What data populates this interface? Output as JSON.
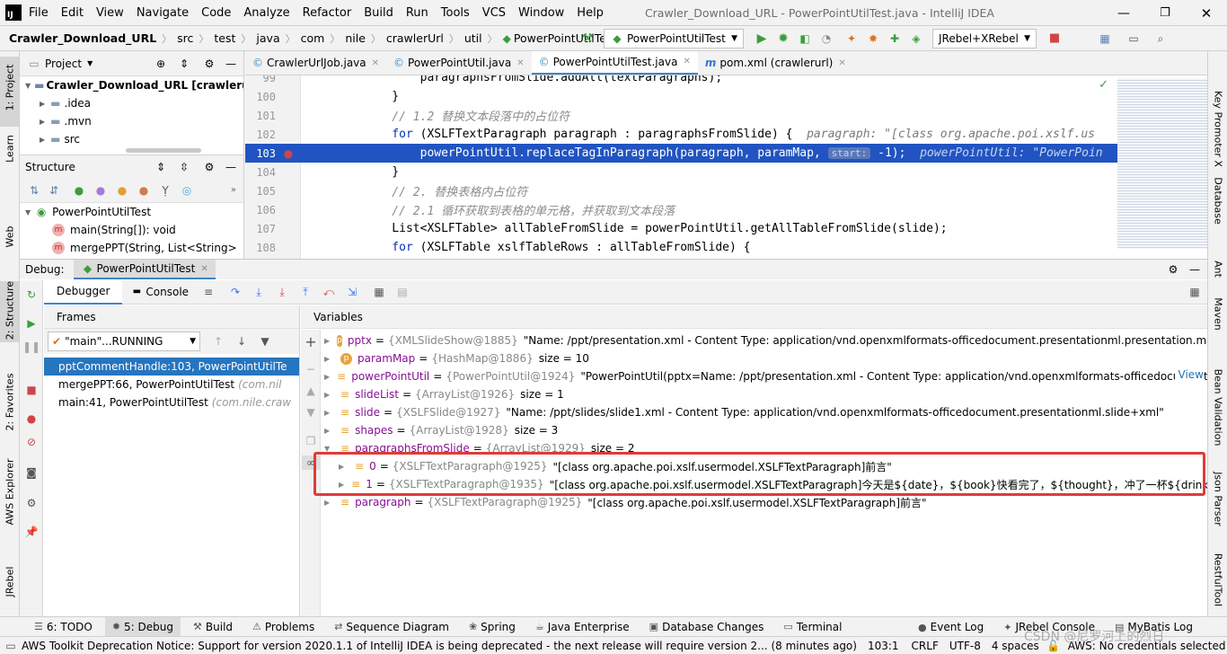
{
  "menu": {
    "logo": "IJ",
    "items": [
      "File",
      "Edit",
      "View",
      "Navigate",
      "Code",
      "Analyze",
      "Refactor",
      "Build",
      "Run",
      "Tools",
      "VCS",
      "Window",
      "Help"
    ],
    "title": "Crawler_Download_URL - PowerPointUtilTest.java - IntelliJ IDEA"
  },
  "breadcrumb": [
    "Crawler_Download_URL",
    "src",
    "test",
    "java",
    "com",
    "nile",
    "crawlerUrl",
    "util",
    "PowerPointUtilTest"
  ],
  "toolbar": {
    "run_config": "PowerPointUtilTest",
    "jrebel_config": "JRebel+XRebel"
  },
  "left_strip": [
    "1: Project",
    "Learn",
    "Web",
    "2: Structure",
    "2: Favorites",
    "AWS Explorer",
    "JRebel"
  ],
  "right_strip": [
    "Key Promoter X",
    "Database",
    "Ant",
    "Maven",
    "Bean Validation",
    "Json Parser",
    "RestfulTool"
  ],
  "project": {
    "title": "Project",
    "root": "Crawler_Download_URL [crawlerurl]",
    "items": [
      ".idea",
      ".mvn",
      "src"
    ]
  },
  "structure": {
    "title": "Structure",
    "class_name": "PowerPointUtilTest",
    "members": [
      "main(String[]): void",
      "mergePPT(String, List<String>"
    ]
  },
  "tabs": [
    {
      "label": "CrawlerUrlJob.java",
      "active": false
    },
    {
      "label": "PowerPointUtil.java",
      "active": false
    },
    {
      "label": "PowerPointUtilTest.java",
      "active": true
    },
    {
      "label": "pom.xml (crawlerurl)",
      "active": false
    }
  ],
  "editor": {
    "line_numbers": [
      "99",
      "100",
      "101",
      "102",
      "103",
      "104",
      "105",
      "106",
      "107",
      "108"
    ],
    "lines": [
      {
        "parts": [
          {
            "t": "        paragraphsFromSlide.addAll(textParagraphs);",
            "c": ""
          }
        ]
      },
      {
        "parts": [
          {
            "t": "    }",
            "c": ""
          }
        ]
      },
      {
        "parts": [
          {
            "t": "    // 1.2 替换文本段落中的占位符",
            "c": "cm"
          }
        ]
      },
      {
        "parts": [
          {
            "t": "    for",
            "c": "kw"
          },
          {
            "t": " (XSLFTextParagraph paragraph : paragraphsFromSlide) {  ",
            "c": ""
          },
          {
            "t": "paragraph: \"[class org.apache.poi.xslf.us",
            "c": "hint"
          }
        ]
      },
      {
        "parts": [
          {
            "t": "        powerPointUtil.replaceTagInParagraph(paragraph, paramMap, ",
            "c": ""
          },
          {
            "t": "start:",
            "c": "badge"
          },
          {
            "t": " -1);  ",
            "c": ""
          },
          {
            "t": "powerPointUtil: \"PowerPoin",
            "c": "hint"
          }
        ]
      },
      {
        "parts": [
          {
            "t": "    }",
            "c": ""
          }
        ]
      },
      {
        "parts": [
          {
            "t": "    // 2. 替换表格内占位符",
            "c": "cm"
          }
        ]
      },
      {
        "parts": [
          {
            "t": "    // 2.1 循环获取到表格的单元格，并获取到文本段落",
            "c": "cm"
          }
        ]
      },
      {
        "parts": [
          {
            "t": "    List<XSLFTable> allTableFromSlide = powerPointUtil.getAllTableFromSlide(slide);",
            "c": ""
          }
        ]
      },
      {
        "parts": [
          {
            "t": "    for",
            "c": "kw"
          },
          {
            "t": " (XSLFTable xslfTableRows : allTableFromSlide) {",
            "c": ""
          }
        ]
      }
    ]
  },
  "debug": {
    "label": "Debug:",
    "session": "PowerPointUtilTest",
    "tab_debugger": "Debugger",
    "tab_console": "Console",
    "frames_title": "Frames",
    "thread": "\"main\"...RUNNING",
    "frames": [
      {
        "method": "pptCommentHandle:103, PowerPointUtilTe",
        "pkg": "",
        "selected": true
      },
      {
        "method": "mergePPT:66, PowerPointUtilTest",
        "pkg": "(com.nil",
        "selected": false
      },
      {
        "method": "main:41, PowerPointUtilTest",
        "pkg": "(com.nile.craw",
        "selected": false
      }
    ],
    "variables_title": "Variables",
    "view_link": "View",
    "variables": [
      {
        "icon": "p",
        "name": "pptx",
        "type": "{XMLSlideShow@1885}",
        "value": "\"Name: /ppt/presentation.xml - Content Type: application/vnd.openxmlformats-officedocument.presentationml.presentation.main+xml\"",
        "indent": 0
      },
      {
        "icon": "p",
        "name": "paramMap",
        "type": "{HashMap@1886}",
        "value": "size = 10",
        "indent": 0
      },
      {
        "icon": "f",
        "name": "powerPointUtil",
        "type": "{PowerPointUtil@1924}",
        "value": "\"PowerPointUtil(pptx=Name: /ppt/presentation.xml - Content Type: application/vnd.openxmlformats-officedocument.p",
        "indent": 0
      },
      {
        "icon": "f",
        "name": "slideList",
        "type": "{ArrayList@1926}",
        "value": "size = 1",
        "indent": 0
      },
      {
        "icon": "f",
        "name": "slide",
        "type": "{XSLFSlide@1927}",
        "value": "\"Name: /ppt/slides/slide1.xml - Content Type: application/vnd.openxmlformats-officedocument.presentationml.slide+xml\"",
        "indent": 0
      },
      {
        "icon": "f",
        "name": "shapes",
        "type": "{ArrayList@1928}",
        "value": "size = 3",
        "indent": 0
      },
      {
        "icon": "f",
        "name": "paragraphsFromSlide",
        "type": "{ArrayList@1929}",
        "value": "size = 2",
        "indent": 0,
        "expanded": true
      },
      {
        "icon": "f",
        "name": "0",
        "type": "{XSLFTextParagraph@1925}",
        "value": "\"[class org.apache.poi.xslf.usermodel.XSLFTextParagraph]前言\"",
        "indent": 1
      },
      {
        "icon": "f",
        "name": "1",
        "type": "{XSLFTextParagraph@1935}",
        "value": "\"[class org.apache.poi.xslf.usermodel.XSLFTextParagraph]今天是${date}，${book}快看完了，${thought}，冲了一杯${drink}，${doing}。",
        "indent": 1
      },
      {
        "icon": "f",
        "name": "paragraph",
        "type": "{XSLFTextParagraph@1925}",
        "value": "\"[class org.apache.poi.xslf.usermodel.XSLFTextParagraph]前言\"",
        "indent": 0
      }
    ]
  },
  "bottom_tabs": [
    "6: TODO",
    "5: Debug",
    "Build",
    "Problems",
    "Sequence Diagram",
    "Spring",
    "Java Enterprise",
    "Database Changes",
    "Terminal"
  ],
  "bottom_right_tabs": [
    "Event Log",
    "JRebel Console",
    "MyBatis Log"
  ],
  "status": {
    "message": "AWS Toolkit Deprecation Notice: Support for version 2020.1.1 of IntelliJ IDEA is being deprecated - the next release will require version 2... (8 minutes ago)",
    "position": "103:1",
    "line_sep": "CRLF",
    "encoding": "UTF-8",
    "indent": "4 spaces",
    "aws": "AWS: No credentials selected"
  },
  "watermark": "CSDN @尼罗河上的烈日",
  "colors": {
    "selection": "#2154c2",
    "frame_selected": "#2675bf",
    "highlight_box": "#e03a3a",
    "accent": "#3574f0"
  }
}
